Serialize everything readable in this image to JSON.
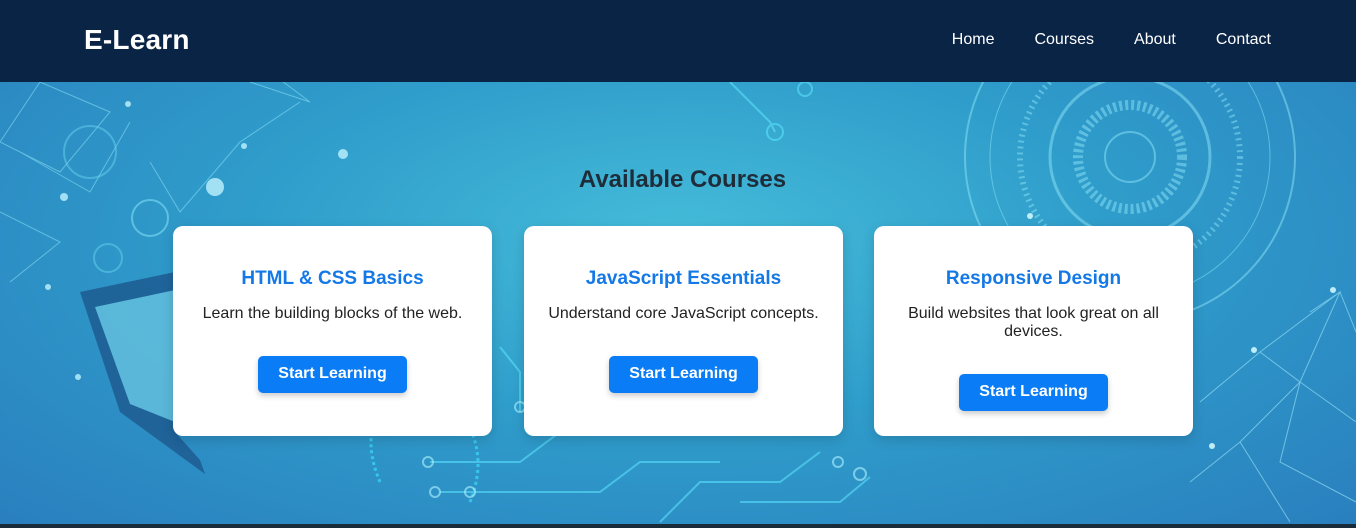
{
  "nav": {
    "brand": "E-Learn",
    "links": [
      "Home",
      "Courses",
      "About",
      "Contact"
    ]
  },
  "hero": {
    "title": "Available Courses"
  },
  "courses": [
    {
      "title": "HTML & CSS Basics",
      "description": "Learn the building blocks of the web.",
      "button": "Start Learning"
    },
    {
      "title": "JavaScript Essentials",
      "description": "Understand core JavaScript concepts.",
      "button": "Start Learning"
    },
    {
      "title": "Responsive Design",
      "description": "Build websites that look great on all devices.",
      "button": "Start Learning"
    }
  ],
  "colors": {
    "navbar": "#0a2446",
    "accent": "#0a7cf5",
    "course_title": "#1479e6"
  }
}
